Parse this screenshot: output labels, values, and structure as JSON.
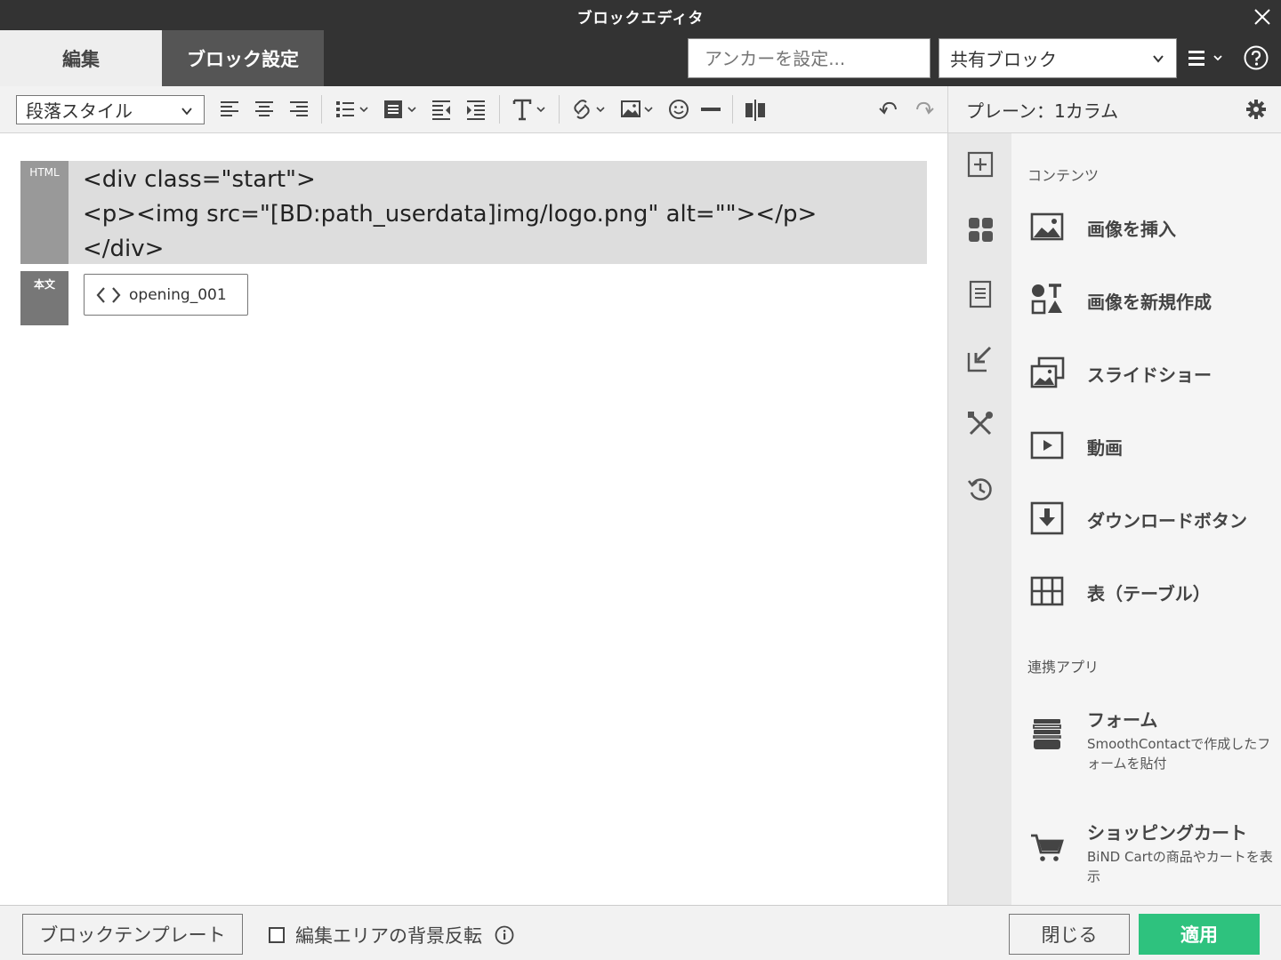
{
  "window": {
    "title": "ブロックエディタ"
  },
  "tabs": [
    {
      "label": "編集"
    },
    {
      "label": "ブロック設定"
    }
  ],
  "header": {
    "anchor_placeholder": "アンカーを設定...",
    "shared_block": "共有ブロック"
  },
  "toolbar": {
    "paragraph_style": "段落スタイル"
  },
  "right_panel": {
    "title": "プレーン：1カラム",
    "sections": [
      {
        "title": "コンテンツ",
        "items": [
          {
            "label": "画像を挿入",
            "icon": "image-icon"
          },
          {
            "label": "画像を新規作成",
            "icon": "shapes-icon"
          },
          {
            "label": "スライドショー",
            "icon": "slideshow-icon"
          },
          {
            "label": "動画",
            "icon": "video-icon"
          },
          {
            "label": "ダウンロードボタン",
            "icon": "download-icon"
          },
          {
            "label": "表（テーブル）",
            "icon": "table-icon"
          }
        ]
      },
      {
        "title": "連携アプリ",
        "items": [
          {
            "label": "フォーム",
            "desc": "SmoothContactで作成したフォームを貼付",
            "icon": "form-icon"
          },
          {
            "label": "ショッピングカート",
            "desc": "BiND Cartの商品やカートを表示",
            "icon": "cart-icon"
          }
        ]
      }
    ]
  },
  "canvas": {
    "html_block": {
      "tag": "HTML",
      "lines": [
        "<div class=\"start\">",
        "<p><img src=\"[BD:path_userdata]img/logo.png\" alt=\"\"></p>",
        "</div>"
      ]
    },
    "text_block": {
      "tag": "本文",
      "part_name": "opening_001"
    }
  },
  "footer": {
    "template_button": "ブロックテンプレート",
    "invert_label": "編集エリアの背景反転",
    "close_button": "閉じる",
    "apply_button": "適用"
  },
  "colors": {
    "apply": "#2ec27e",
    "titlebar": "#333333",
    "active_tab": "#555555"
  }
}
